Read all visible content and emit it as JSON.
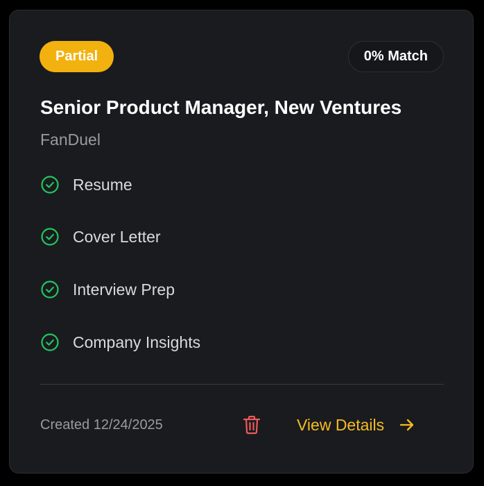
{
  "card": {
    "status_badge": "Partial",
    "match_badge": "0% Match",
    "job_title": "Senior Product Manager, New Ventures",
    "company": "FanDuel",
    "features": [
      {
        "label": "Resume",
        "icon": "check-circle-icon"
      },
      {
        "label": "Cover Letter",
        "icon": "check-circle-icon"
      },
      {
        "label": "Interview Prep",
        "icon": "check-circle-icon"
      },
      {
        "label": "Company Insights",
        "icon": "check-circle-icon"
      }
    ],
    "created": "Created 12/24/2025",
    "view_details": "View Details"
  },
  "colors": {
    "card_background": "#1a1b1f",
    "status_badge": "#f2b10e",
    "check_green": "#22c55e",
    "trash_red": "#ef5a5a",
    "accent_yellow": "#f5bd1f"
  },
  "icons": {
    "delete": "trash-icon",
    "view_details": "arrow-right-icon"
  }
}
